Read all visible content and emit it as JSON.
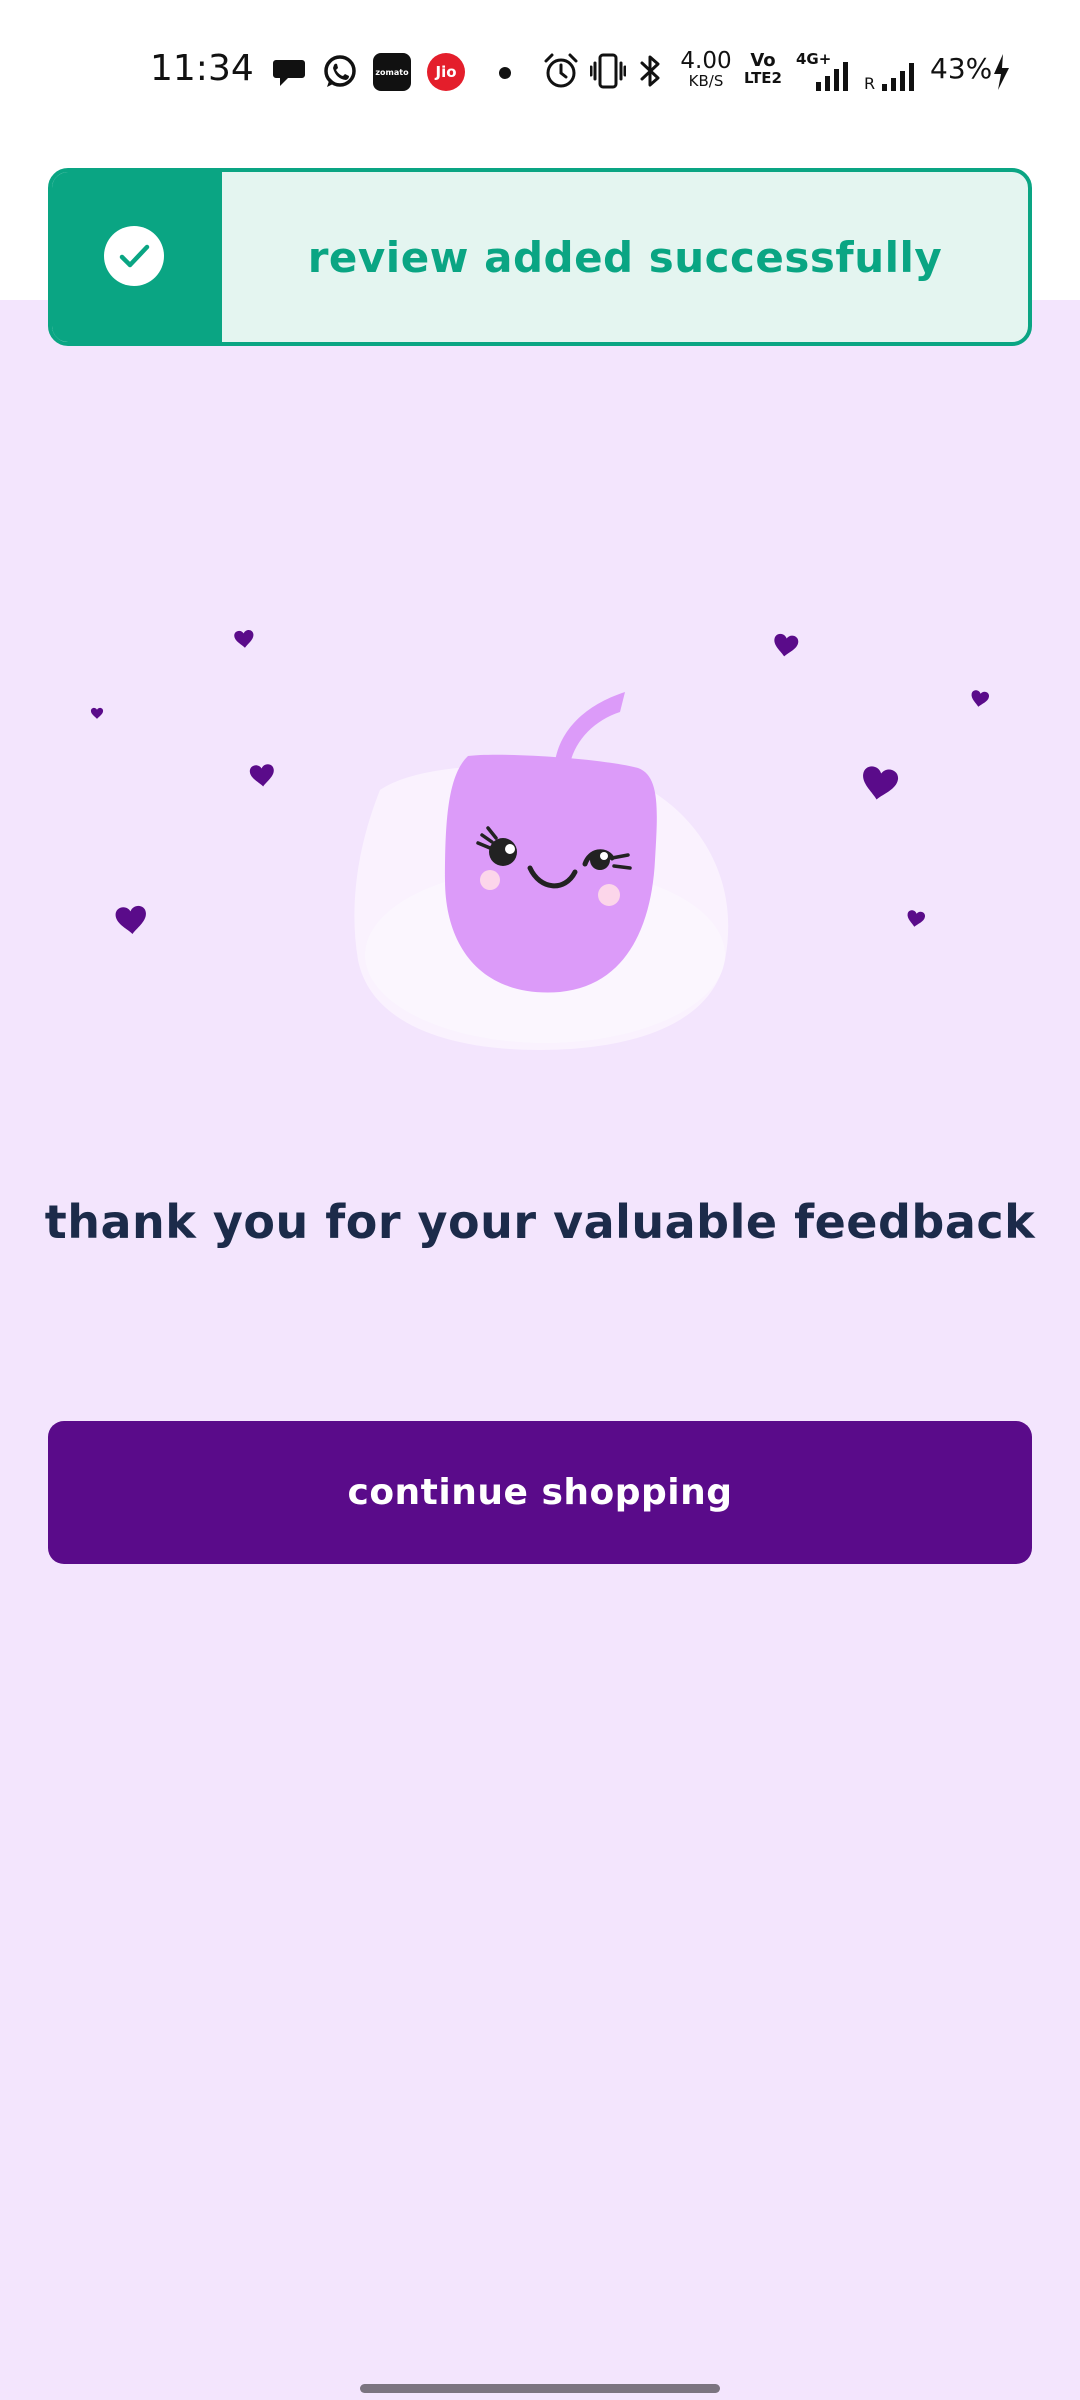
{
  "status_bar": {
    "time": "11:34",
    "network_speed_value": "4.00",
    "network_speed_unit": "KB/S",
    "volte_top": "Vo",
    "volte_bottom": "LTE2",
    "network_type": "4G+",
    "roaming": "R",
    "battery": "43%",
    "notification_icons": [
      "chat-bubble-icon",
      "whatsapp-icon",
      "zomato-icon",
      "jio-icon",
      "dot-icon"
    ],
    "system_icons": [
      "alarm-icon",
      "vibrate-icon",
      "bluetooth-icon",
      "signal-icon",
      "charging-icon"
    ],
    "zomato_label": "zomato",
    "jio_label": "Jio"
  },
  "toast": {
    "message": "review added successfully",
    "icon": "check-circle-icon",
    "accent_color": "#0AA583",
    "background_color": "#E4F5F0"
  },
  "illustration": {
    "description_icon": "winking-fruit-icon",
    "decorations": "heart-icon",
    "heart_color": "#5A0B8A",
    "character_color": "#DC9BF9"
  },
  "main": {
    "message": "thank you for your valuable feedback",
    "button_label": "continue shopping",
    "button_color": "#5A0B8A",
    "background_color": "#F3E5FD"
  }
}
